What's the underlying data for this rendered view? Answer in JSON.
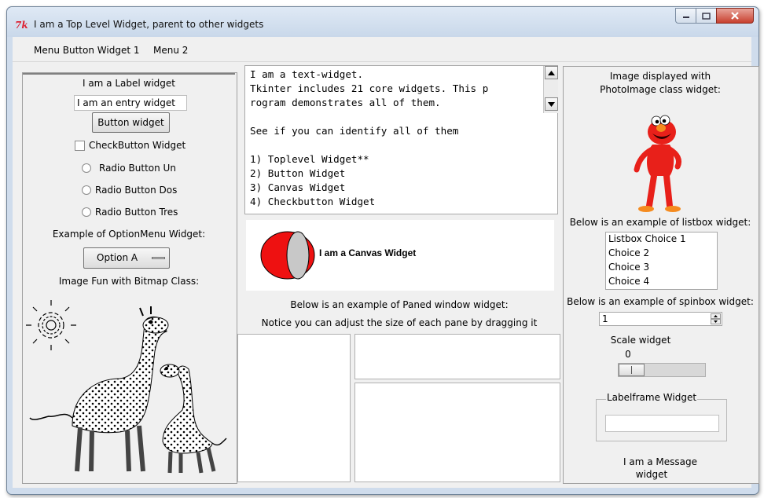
{
  "window": {
    "title": "I am a Top Level Widget, parent to other widgets",
    "logo_text": "7k"
  },
  "menubar": {
    "items": [
      "Menu Button Widget 1",
      "Menu 2"
    ]
  },
  "left": {
    "label": "I am a Label widget",
    "entry_value": "I am an entry widget",
    "button_label": "Button widget",
    "checkbutton_label": "CheckButton Widget",
    "radio_buttons": [
      "Radio Button  Un",
      "Radio Button  Dos",
      "Radio Button  Tres"
    ],
    "optionmenu_caption": "Example of OptionMenu Widget:",
    "optionmenu_value": "Option A",
    "bitmap_caption": "Image Fun with Bitmap Class:"
  },
  "center": {
    "text_lines": [
      "I am a text-widget.",
      "Tkinter includes 21 core widgets. This p",
      "rogram demonstrates all of them.",
      "",
      "See if you can identify all of them",
      "",
      "1) Toplevel Widget**",
      "2) Button Widget",
      "3) Canvas Widget",
      "4) Checkbutton Widget"
    ],
    "canvas_text": "I am a Canvas Widget",
    "paned_caption_1": "Below is an example of Paned window widget:",
    "paned_caption_2": "Notice you can adjust the size of each pane by dragging it"
  },
  "right": {
    "photo_caption_1": "Image displayed with",
    "photo_caption_2": "PhotoImage class widget:",
    "listbox_caption": "Below is an example of listbox widget:",
    "listbox_items": [
      "Listbox Choice 1",
      "Choice 2",
      "Choice 3",
      "Choice 4"
    ],
    "spinbox_caption": "Below is an example of spinbox widget:",
    "spinbox_value": "1",
    "scale_caption": "Scale widget",
    "scale_value": "0",
    "labelframe_caption": "Labelframe Widget",
    "message_line_1": "I am a Message",
    "message_line_2": "widget"
  },
  "colors": {
    "canvas_arc_red": "#ee1111",
    "canvas_arc_grey": "#c8c8c8",
    "elmo_red": "#e8201a",
    "close_button": "#c8402e"
  },
  "icons": [
    "minimize-icon",
    "maximize-icon",
    "close-icon",
    "scroll-up-arrow-icon",
    "scroll-down-arrow-icon",
    "option-menu-indicator-icon",
    "spinbox-up-icon",
    "spinbox-down-icon"
  ]
}
